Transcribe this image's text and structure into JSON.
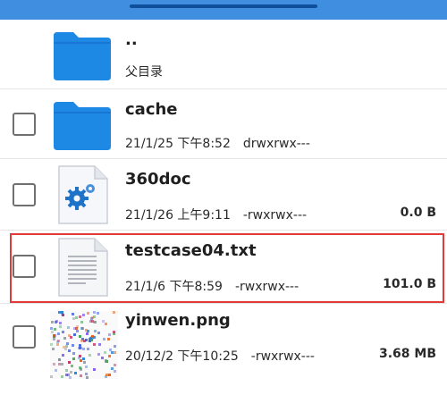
{
  "header": {
    "accent": "#3f8ee0",
    "indicator_color": "#0f4f9a"
  },
  "files": [
    {
      "name": "..",
      "meta": "父目录",
      "icon": "folder-icon"
    },
    {
      "name": "cache",
      "date": "21/1/25 下午8:52",
      "perm": "drwxrwx---",
      "size": "",
      "icon": "folder-icon"
    },
    {
      "name": "360doc",
      "date": "21/1/26 上午9:11",
      "perm": "-rwxrwx---",
      "size": "0.0 B",
      "icon": "settings-file-icon"
    },
    {
      "name": "testcase04.txt",
      "date": "21/1/6 下午8:59",
      "perm": "-rwxrwx---",
      "size": "101.0 B",
      "icon": "text-file-icon",
      "highlighted": true
    },
    {
      "name": "yinwen.png",
      "date": "20/12/2 下午10:25",
      "perm": "-rwxrwx---",
      "size": "3.68 MB",
      "icon": "image-thumbnail"
    }
  ],
  "colors": {
    "folder": "#1e88e5",
    "highlight": "#e03a3a"
  }
}
